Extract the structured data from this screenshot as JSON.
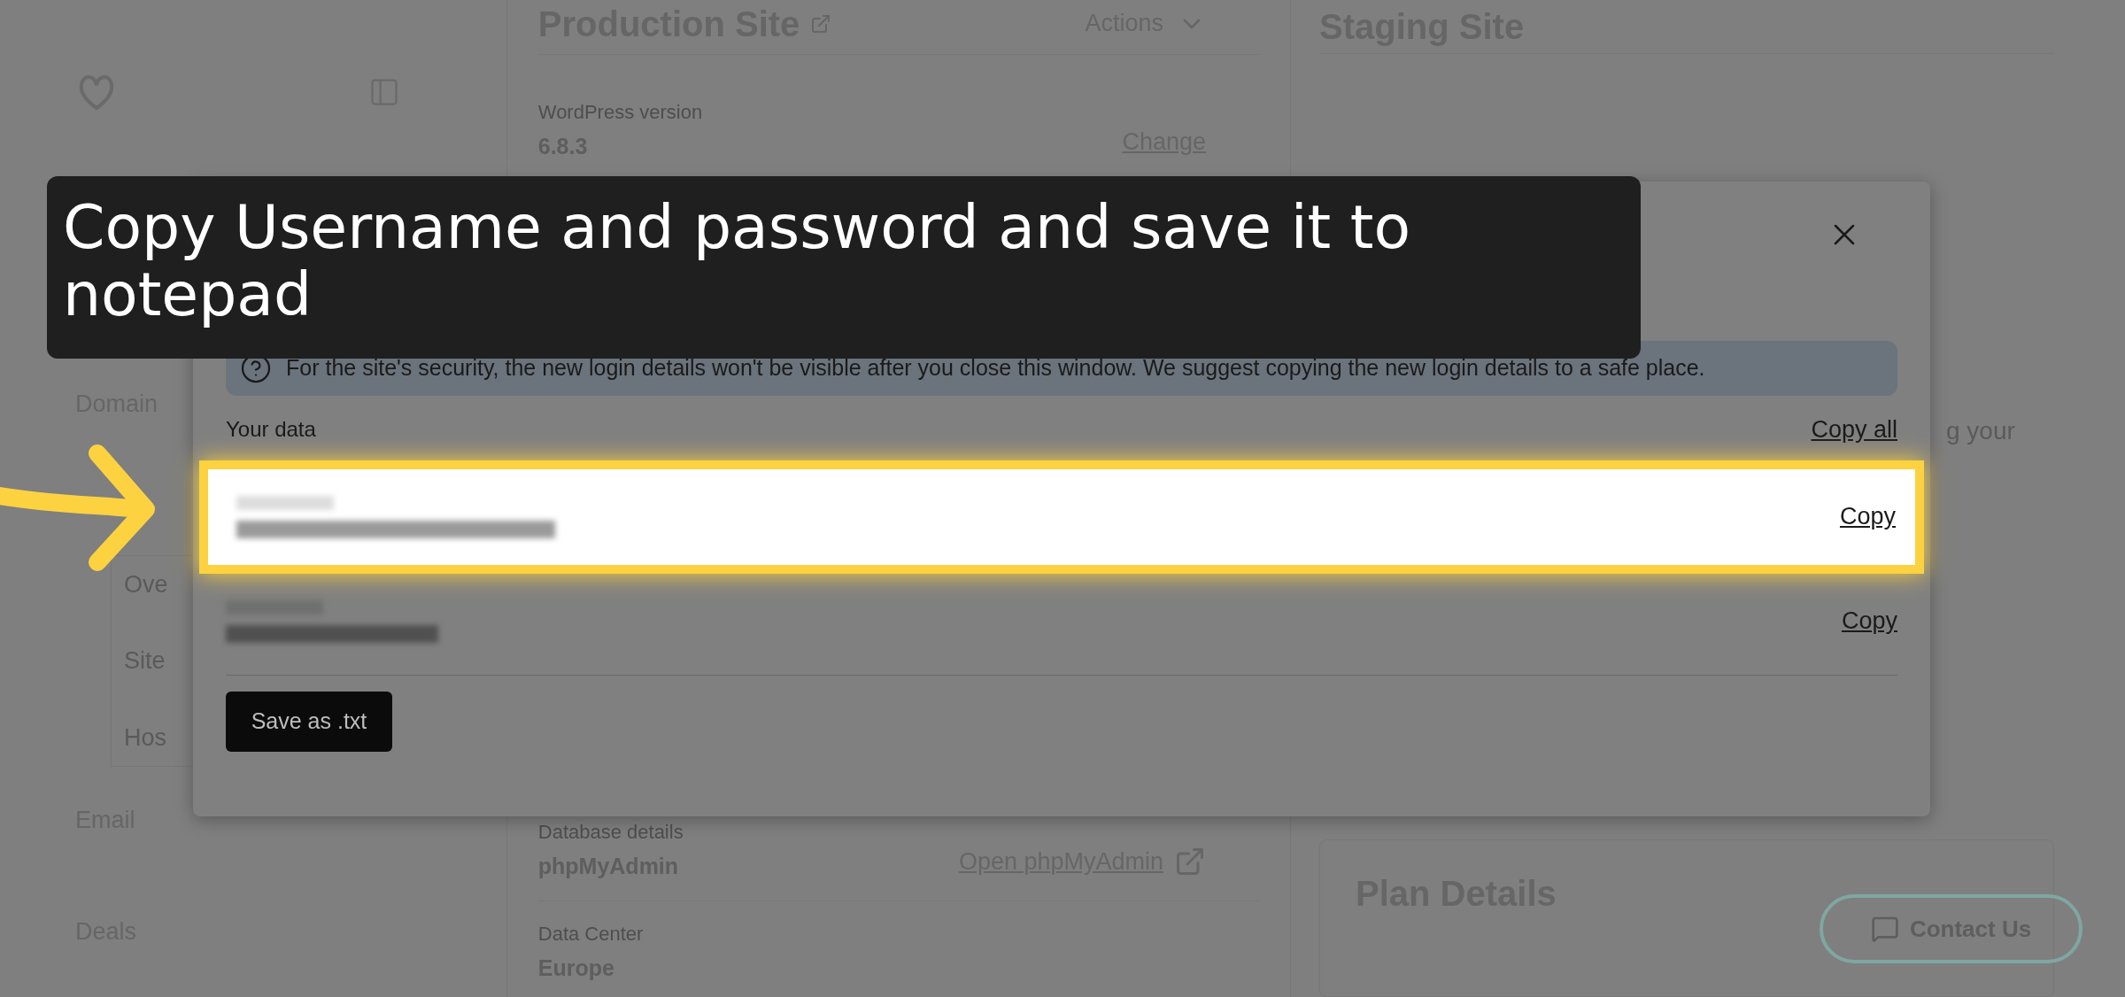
{
  "sidebar": {
    "items": [
      {
        "label": "Domain"
      },
      {
        "label": "Email"
      },
      {
        "label": "Deals"
      }
    ],
    "subitems": [
      {
        "label": "Ove"
      },
      {
        "label": "Site"
      },
      {
        "label": "Hos"
      }
    ]
  },
  "production": {
    "title": "Production Site",
    "actions": "Actions",
    "fields": [
      {
        "label": "WordPress version",
        "value": "6.8.3",
        "link": "Change"
      },
      {
        "label": "Database details",
        "value": "phpMyAdmin",
        "link": "Open phpMyAdmin"
      },
      {
        "label": "Data Center",
        "value": "Europe"
      }
    ]
  },
  "staging": {
    "title": "Staging Site",
    "partial_text": "g your"
  },
  "plan": {
    "title": "Plan Details"
  },
  "contact_button": "Contact Us",
  "modal": {
    "notice": "For the site's security, the new login details won't be visible after you close this window. We suggest copying the new login details to a safe place.",
    "section_label": "Your data",
    "copy_all": "Copy all",
    "rows": [
      {
        "copy": "Copy",
        "highlighted": true
      },
      {
        "copy": "Copy",
        "highlighted": false
      }
    ],
    "save_button": "Save as .txt"
  },
  "caption": "Copy Username and password and save it to notepad"
}
